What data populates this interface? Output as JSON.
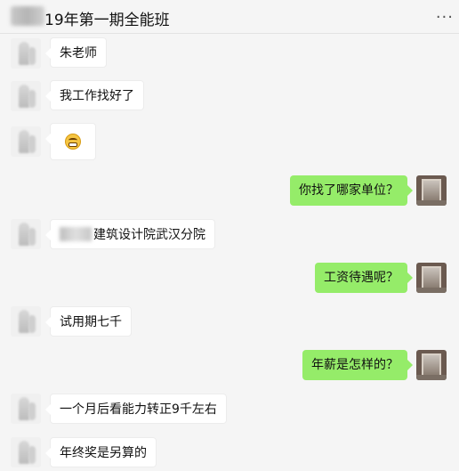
{
  "header": {
    "title": "19年第一期全能班",
    "more_icon": "more-icon",
    "more_glyph": "···"
  },
  "messages": [
    {
      "side": "left",
      "text": "朱老师"
    },
    {
      "side": "left",
      "text": "我工作找好了"
    },
    {
      "side": "left",
      "text": "",
      "emoji": "grimacing-face-icon"
    },
    {
      "side": "right",
      "text": "你找了哪家单位？"
    },
    {
      "side": "left",
      "text": "建筑设计院武汉分院",
      "redacted_prefix": true
    },
    {
      "side": "right",
      "text": "工资待遇呢？"
    },
    {
      "side": "left",
      "text": "试用期七千"
    },
    {
      "side": "right",
      "text": "年薪是怎样的？"
    },
    {
      "side": "left",
      "text": "一个月后看能力转正9千左右"
    },
    {
      "side": "left",
      "text": "年终奖是另算的"
    }
  ],
  "colors": {
    "background": "#f5f5f5",
    "own_bubble": "#95ec69",
    "other_bubble": "#ffffff"
  }
}
